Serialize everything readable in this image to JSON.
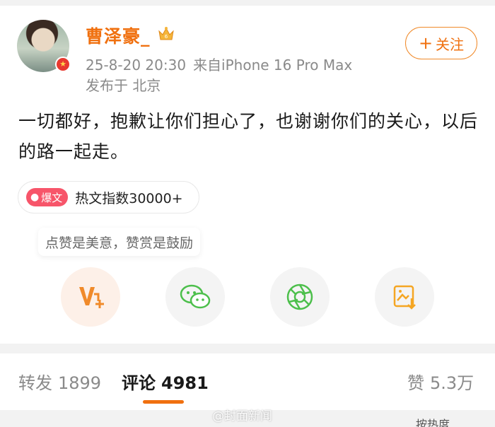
{
  "post": {
    "username": "曹泽豪_",
    "datetime": "25-8-20 20:30",
    "source": "来自iPhone 16 Pro Max",
    "location": "发布于 北京",
    "follow_label": "关注",
    "text": "一切都好，抱歉让你们担心了，也谢谢你们的关心，以后的路一起走。",
    "hot_badge": "爆文",
    "hot_label": "热文指数30000+"
  },
  "actions": {
    "tip": "点赞是美意，赞赏是鼓励",
    "icons": [
      "reward-icon",
      "wechat-icon",
      "moments-icon",
      "save-image-icon"
    ]
  },
  "tabs": {
    "repost_label": "转发",
    "repost_count": "1899",
    "comment_label": "评论",
    "comment_count": "4981",
    "like_label": "赞",
    "like_count": "5.3万"
  },
  "sort_label": "按热度",
  "watermark": "@封面新闻",
  "colors": {
    "accent": "#f0700f",
    "wechat": "#4cbf4b",
    "hot_badge": "#f7556a",
    "save_icon": "#f5a623"
  }
}
